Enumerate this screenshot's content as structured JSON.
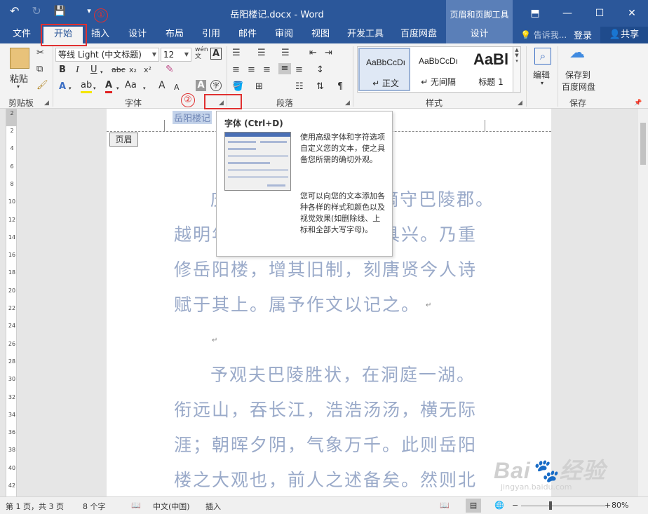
{
  "window": {
    "title": "岳阳楼记.docx - Word",
    "context_tab_title": "页眉和页脚工具",
    "qat": {
      "undo": "↶",
      "redo": "↻",
      "save": "💾",
      "customize": "▾"
    },
    "controls": {
      "restore_ribbon": "⬒",
      "minimize": "—",
      "maximize": "☐",
      "close": "✕"
    }
  },
  "tabs": [
    {
      "label": "文件"
    },
    {
      "label": "开始"
    },
    {
      "label": "插入"
    },
    {
      "label": "设计"
    },
    {
      "label": "布局"
    },
    {
      "label": "引用"
    },
    {
      "label": "邮件"
    },
    {
      "label": "审阅"
    },
    {
      "label": "视图"
    },
    {
      "label": "开发工具"
    },
    {
      "label": "百度网盘"
    },
    {
      "label": "设计"
    }
  ],
  "tell_me": "告诉我...",
  "login": "登录",
  "share": "共享",
  "ribbon": {
    "clipboard": {
      "label": "剪贴板",
      "paste": "粘贴"
    },
    "font": {
      "label": "字体",
      "font_name": "等线 Light (中文标题)",
      "font_size": "12",
      "wen_icon": "wén",
      "bold": "B",
      "italic": "I",
      "underline": "U",
      "strike": "abc",
      "subscript": "x₂",
      "superscript": "x²",
      "grow": "A",
      "shrink": "A",
      "aa": "Aa",
      "char_border": "A",
      "char_shade": "A",
      "phonetic": "字"
    },
    "paragraph": {
      "label": "段落"
    },
    "styles": {
      "label": "样式",
      "items": [
        {
          "preview": "AaBbCcDı",
          "name": "↵ 正文"
        },
        {
          "preview": "AaBbCcDı",
          "name": "↵ 无间隔"
        },
        {
          "preview": "AaBl",
          "name": "标题 1"
        }
      ]
    },
    "editing": {
      "label": "编辑"
    },
    "save_group": {
      "label": "保存",
      "button_line1": "保存到",
      "button_line2": "百度网盘"
    }
  },
  "document": {
    "header_tag": "页眉",
    "header_text": "岳阳楼记",
    "lines": [
      "庆历四年春，滕子京谪守巴陵郡。",
      "越明年，政通人和，百废具兴。乃重",
      "修岳阳楼，增其旧制，刻唐贤今人诗",
      "赋于其上。属予作文以记之。",
      "予观夫巴陵胜状，在洞庭一湖。",
      "衔远山，吞长江，浩浩汤汤，横无际",
      "涯；朝晖夕阴，气象万千。此则岳阳",
      "楼之大观也，前人之述备矣。然则北"
    ],
    "ruler_numbers": [
      "2",
      "2",
      "4",
      "6",
      "8",
      "10",
      "12",
      "14",
      "16",
      "18",
      "20",
      "22",
      "24",
      "26",
      "28",
      "30",
      "32",
      "34",
      "36",
      "38",
      "40",
      "42"
    ]
  },
  "tooltip": {
    "title": "字体 (Ctrl+D)",
    "desc1": "使用高级字体和字符选项自定义您的文本，使之具备您所需的确切外观。",
    "desc2": "您可以向您的文本添加各种各样的样式和颜色以及视觉效果(如删除线、上标和全部大写字母)。"
  },
  "annotations": {
    "step1": "①",
    "step2": "②"
  },
  "statusbar": {
    "page": "第 1 页，共 3 页",
    "words": "8 个字",
    "language": "中文(中国)",
    "mode": "插入",
    "zoom": "80%"
  },
  "watermark": {
    "main": "Bai🐾经验",
    "sub": "jingyan.baidu.com"
  },
  "colors": {
    "title_bar": "#2b579a",
    "context_tab": "#5a7fb8",
    "annotation": "#e03030",
    "faded_text": "#9aaac9"
  }
}
